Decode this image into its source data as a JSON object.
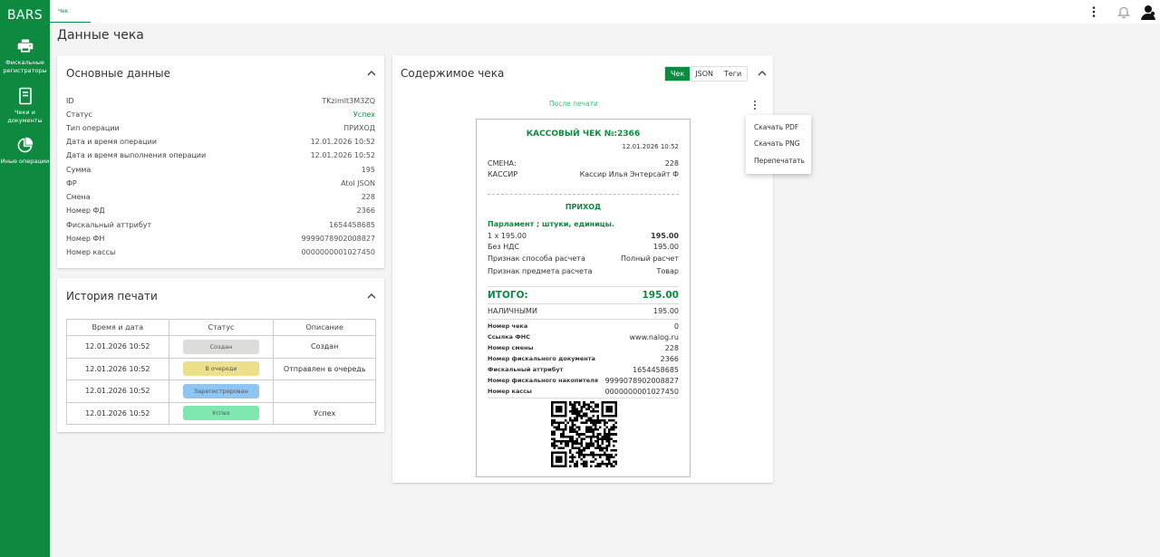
{
  "sidebar": {
    "logo": "BARS",
    "items": [
      {
        "label": "Фискальные\nрегистраторы",
        "icon": "printer-icon"
      },
      {
        "label": "Чеки и\nдокументы",
        "icon": "document-icon"
      },
      {
        "label": "Иные операции",
        "icon": "pie-chart-icon"
      }
    ]
  },
  "topbar": {
    "tab_label": "Чек",
    "icons": [
      "more-vertical-icon",
      "bell-icon",
      "user-avatar-icon"
    ]
  },
  "page_title": "Данные чека",
  "main_data": {
    "title": "Основные данные",
    "rows": [
      {
        "key": "ID",
        "value": "TKzimlt3M3ZQ"
      },
      {
        "key": "Статус",
        "value": "Успех"
      },
      {
        "key": "Тип операции",
        "value": "ПРИХОД"
      },
      {
        "key": "Дата и время операции",
        "value": "12.01.2026 10:52"
      },
      {
        "key": "Дата и время выполнения операции",
        "value": "12.01.2026 10:52"
      },
      {
        "key": "Сумма",
        "value": "195"
      },
      {
        "key": "ФР",
        "value": "Atol JSON"
      },
      {
        "key": "Смена",
        "value": "228"
      },
      {
        "key": "Номер ФД",
        "value": "2366"
      },
      {
        "key": "Фискальный аттрибут",
        "value": "1654458685"
      },
      {
        "key": "Номер ФН",
        "value": "9999078902008827"
      },
      {
        "key": "Номер кассы",
        "value": "0000000001027450"
      }
    ],
    "status_color": "#0d8a3f"
  },
  "history": {
    "title": "История печати",
    "columns": [
      "Время и дата",
      "Статус",
      "Описание"
    ],
    "rows": [
      {
        "time": "12.01.2026 10:52",
        "status": "Создан",
        "desc": "Создан",
        "color": "#dcdcdc"
      },
      {
        "time": "12.01.2026 10:52",
        "status": "В очереди",
        "desc": "Отправлен в очередь",
        "color": "#ede08a"
      },
      {
        "time": "12.01.2026 10:52",
        "status": "Зарегистрирован",
        "desc": "",
        "color": "#8ec5f2"
      },
      {
        "time": "12.01.2026 10:52",
        "status": "Успех",
        "desc": "Успех",
        "color": "#7ee8b0"
      }
    ]
  },
  "content": {
    "title": "Содержимое чека",
    "tabs": [
      "Чек",
      "JSON",
      "Теги"
    ],
    "active_tab": "Чек",
    "after_print_label": "После печати",
    "menu": [
      "Скачать PDF",
      "Скачать PNG",
      "Перепечатать"
    ]
  },
  "receipt": {
    "title": "КАССОВЫЙ ЧЕК №:2366",
    "date": "12.01.2026 10:52",
    "shift_label": "СМЕНА:",
    "shift": "228",
    "cashier_label": "КАССИР",
    "cashier": "Кассир Илья Энтерсайт Ф",
    "op_type": "ПРИХОД",
    "item_name": "Парламент ; штуки, единицы.",
    "item_qty_price": "1 x 195.00",
    "item_total": "195.00",
    "vat_label": "Без НДС",
    "vat_value": "195.00",
    "pay_method_label": "Признак способа расчета",
    "pay_method": "Полный расчет",
    "subject_label": "Признак предмета расчета",
    "subject": "Товар",
    "total_label": "ИТОГО:",
    "total": "195.00",
    "cash_label": "НАЛИЧНЫМИ",
    "cash": "195.00",
    "details": [
      {
        "k": "Номер чека",
        "v": "0"
      },
      {
        "k": "Ссылка ФНС",
        "v": "www.nalog.ru"
      },
      {
        "k": "Номер смены",
        "v": "228"
      },
      {
        "k": "Номер фискального документа",
        "v": "2366"
      },
      {
        "k": "Фискальный аттрибут",
        "v": "1654458685"
      },
      {
        "k": "Номер фискального накопителя",
        "v": "9999078902008827"
      },
      {
        "k": "Номер кассы",
        "v": "0000000001027450"
      }
    ],
    "accent": "#0d8a3f"
  }
}
